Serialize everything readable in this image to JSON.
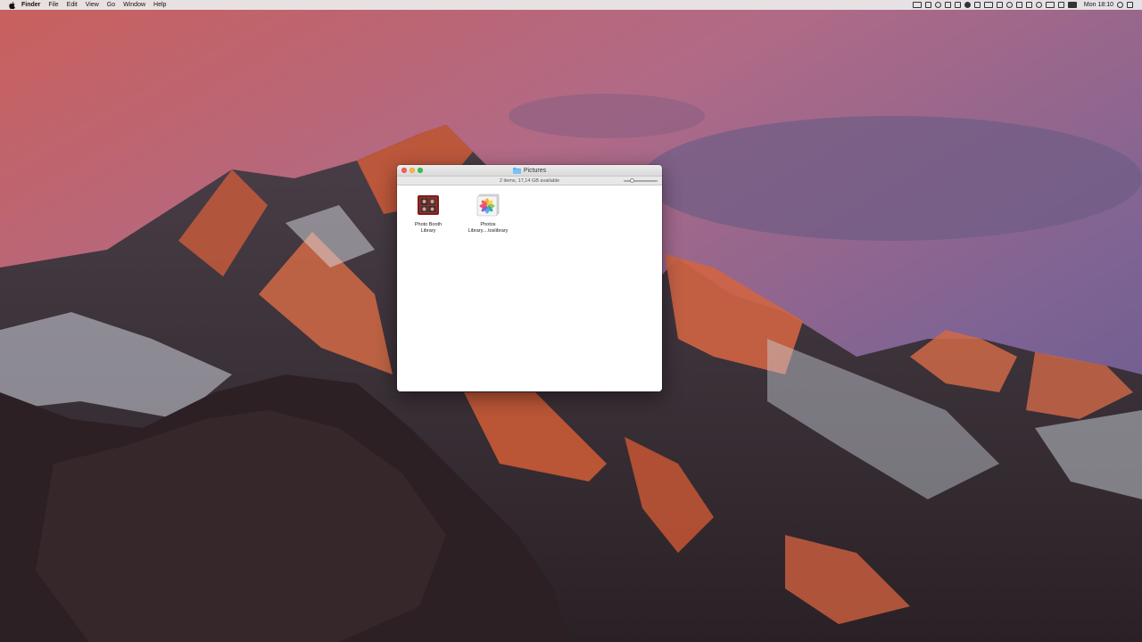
{
  "menubar": {
    "app_name": "Finder",
    "menus": [
      "File",
      "Edit",
      "View",
      "Go",
      "Window",
      "Help"
    ],
    "clock": "Mon 18:10"
  },
  "window": {
    "title": "Pictures",
    "status": "2 items, 17,14 GB available",
    "icon_size_fraction": 0.2,
    "files": [
      {
        "name": "Photo Booth\nLibrary",
        "icon": "photo-booth-library-icon"
      },
      {
        "name": "Photos\nLibrary....toslibrary",
        "icon": "photos-library-icon"
      }
    ]
  },
  "colors": {
    "close": "#fc605c",
    "minimize": "#fdbc40",
    "maximize": "#34c84a",
    "folder": "#5ab0f0"
  }
}
